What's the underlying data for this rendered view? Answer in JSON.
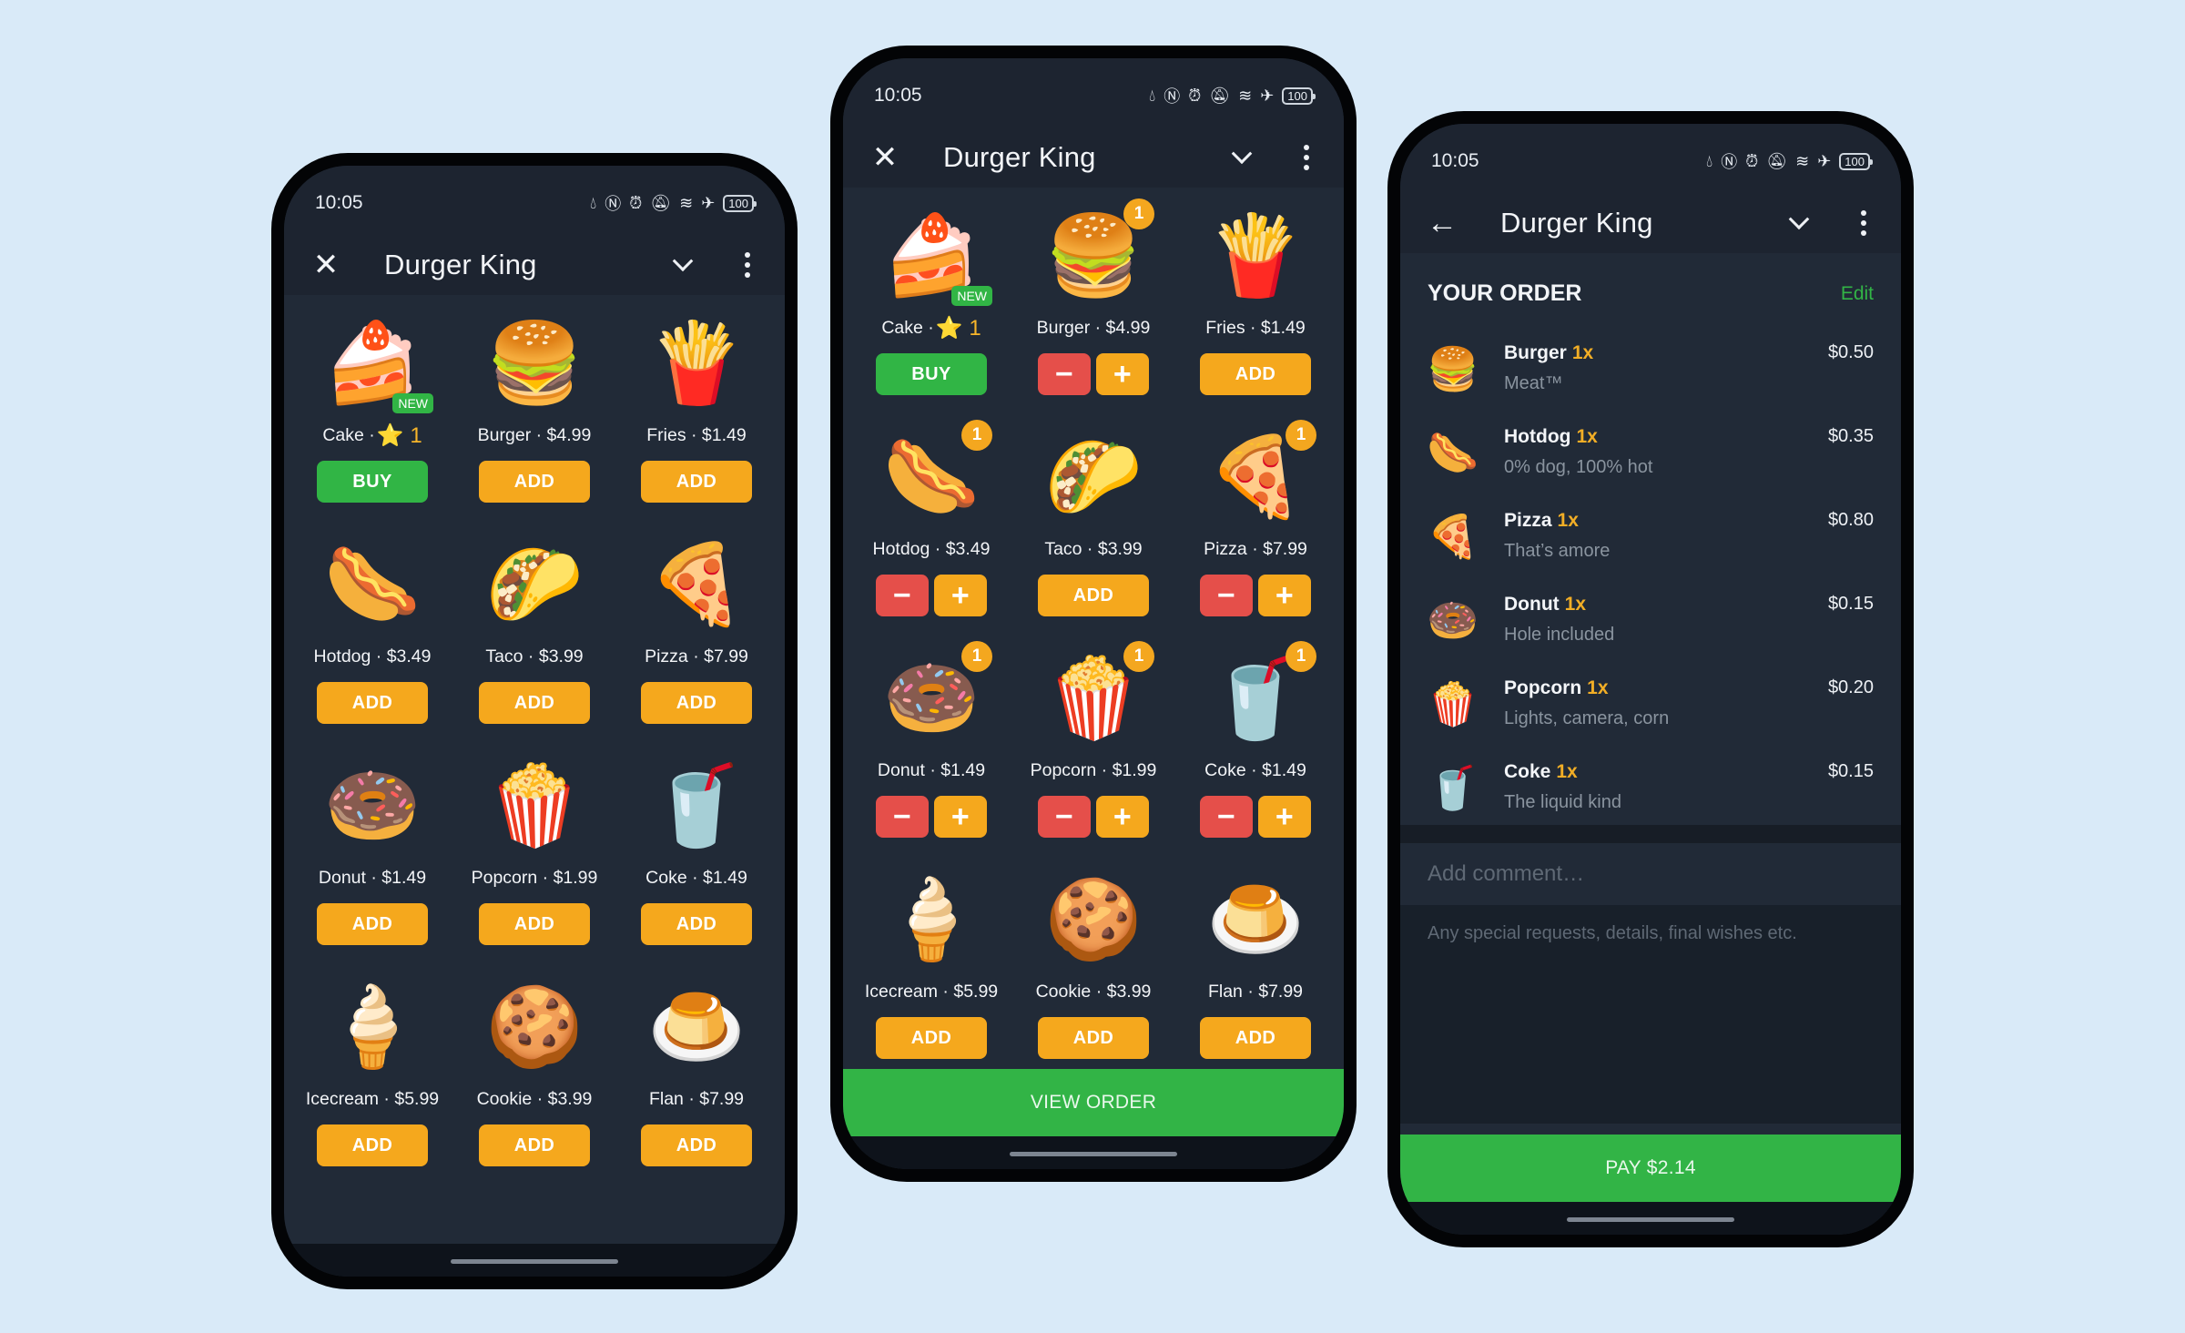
{
  "status_bar": {
    "time": "10:05",
    "icons": [
      "data-saver-icon",
      "nfc-icon",
      "alarm-icon",
      "bell-off-icon",
      "wifi-icon",
      "airplane-icon"
    ],
    "battery": "100"
  },
  "app": {
    "title": "Durger King"
  },
  "colors": {
    "background": "#d9eaf8",
    "add": "#f5a81d",
    "buy": "#31b545",
    "minus": "#e54f4a",
    "accent_green": "#32b446",
    "qty": "#f2ae26"
  },
  "menu": [
    {
      "name": "Cake",
      "emoji": "🍰",
      "label": "Cake · ",
      "price_text": "⭐ 1",
      "tag": "NEW",
      "action": "BUY"
    },
    {
      "name": "Burger",
      "emoji": "🍔",
      "label": "Burger · $4.99",
      "action": "ADD"
    },
    {
      "name": "Fries",
      "emoji": "🍟",
      "label": "Fries · $1.49",
      "action": "ADD"
    },
    {
      "name": "Hotdog",
      "emoji": "🌭",
      "label": "Hotdog · $3.49",
      "action": "ADD"
    },
    {
      "name": "Taco",
      "emoji": "🌮",
      "label": "Taco · $3.99",
      "action": "ADD"
    },
    {
      "name": "Pizza",
      "emoji": "🍕",
      "label": "Pizza · $7.99",
      "action": "ADD"
    },
    {
      "name": "Donut",
      "emoji": "🍩",
      "label": "Donut · $1.49",
      "action": "ADD"
    },
    {
      "name": "Popcorn",
      "emoji": "🍿",
      "label": "Popcorn · $1.99",
      "action": "ADD"
    },
    {
      "name": "Coke",
      "emoji": "🥤",
      "label": "Coke · $1.49",
      "action": "ADD"
    },
    {
      "name": "Icecream",
      "emoji": "🍦",
      "label": "Icecream · $5.99",
      "action": "ADD"
    },
    {
      "name": "Cookie",
      "emoji": "🍪",
      "label": "Cookie · $3.99",
      "action": "ADD"
    },
    {
      "name": "Flan",
      "emoji": "🍮",
      "label": "Flan · $7.99",
      "action": "ADD"
    }
  ],
  "phone2_counts": [
    0,
    1,
    0,
    1,
    0,
    1,
    1,
    1,
    1,
    0,
    0,
    0
  ],
  "labels": {
    "add": "ADD",
    "buy": "BUY",
    "minus": "−",
    "plus": "+",
    "view_order": "VIEW ORDER"
  },
  "order": {
    "title": "YOUR ORDER",
    "edit": "Edit",
    "items": [
      {
        "emoji": "🍔",
        "name": "Burger",
        "qty": "1x",
        "desc": "Meat™",
        "price": "$0.50"
      },
      {
        "emoji": "🌭",
        "name": "Hotdog",
        "qty": "1x",
        "desc": "0% dog, 100% hot",
        "price": "$0.35"
      },
      {
        "emoji": "🍕",
        "name": "Pizza",
        "qty": "1x",
        "desc": "That’s amore",
        "price": "$0.80"
      },
      {
        "emoji": "🍩",
        "name": "Donut",
        "qty": "1x",
        "desc": "Hole included",
        "price": "$0.15"
      },
      {
        "emoji": "🍿",
        "name": "Popcorn",
        "qty": "1x",
        "desc": "Lights, camera, corn",
        "price": "$0.20"
      },
      {
        "emoji": "🥤",
        "name": "Coke",
        "qty": "1x",
        "desc": "The liquid kind",
        "price": "$0.15"
      }
    ],
    "comment_placeholder": "Add comment…",
    "comment_hint": "Any special requests, details, final wishes etc.",
    "pay_label": "PAY $2.14"
  }
}
